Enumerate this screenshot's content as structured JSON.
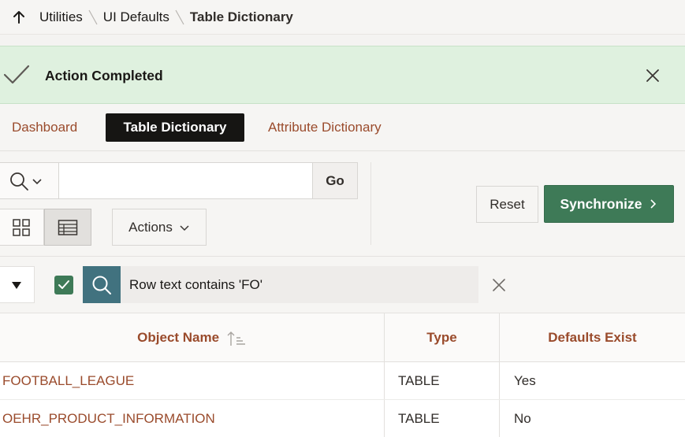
{
  "breadcrumb": {
    "items": [
      "Utilities",
      "UI Defaults"
    ],
    "current": "Table Dictionary",
    "up_icon": "arrow-up-icon"
  },
  "alert": {
    "message": "Action Completed",
    "icon": "check-icon",
    "close_icon": "close-icon"
  },
  "tabs": [
    {
      "label": "Dashboard",
      "active": false
    },
    {
      "label": "Table Dictionary",
      "active": true
    },
    {
      "label": "Attribute Dictionary",
      "active": false
    }
  ],
  "search": {
    "value": "",
    "placeholder": "",
    "go_label": "Go"
  },
  "toolbar": {
    "actions_label": "Actions",
    "reset_label": "Reset",
    "synchronize_label": "Synchronize"
  },
  "filter": {
    "label": "Row text contains 'FO'",
    "enabled": true
  },
  "table": {
    "columns": [
      "Object Name",
      "Type",
      "Defaults Exist"
    ],
    "rows": [
      {
        "object_name": "FOOTBALL_LEAGUE",
        "type": "TABLE",
        "defaults_exist": "Yes"
      },
      {
        "object_name": "OEHR_PRODUCT_INFORMATION",
        "type": "TABLE",
        "defaults_exist": "No"
      }
    ]
  },
  "colors": {
    "link": "#9a4b2c",
    "success_bg": "#dff1df",
    "primary": "#3e7a57",
    "filter_icon_bg": "#41727f",
    "active_tab": "#161513"
  }
}
